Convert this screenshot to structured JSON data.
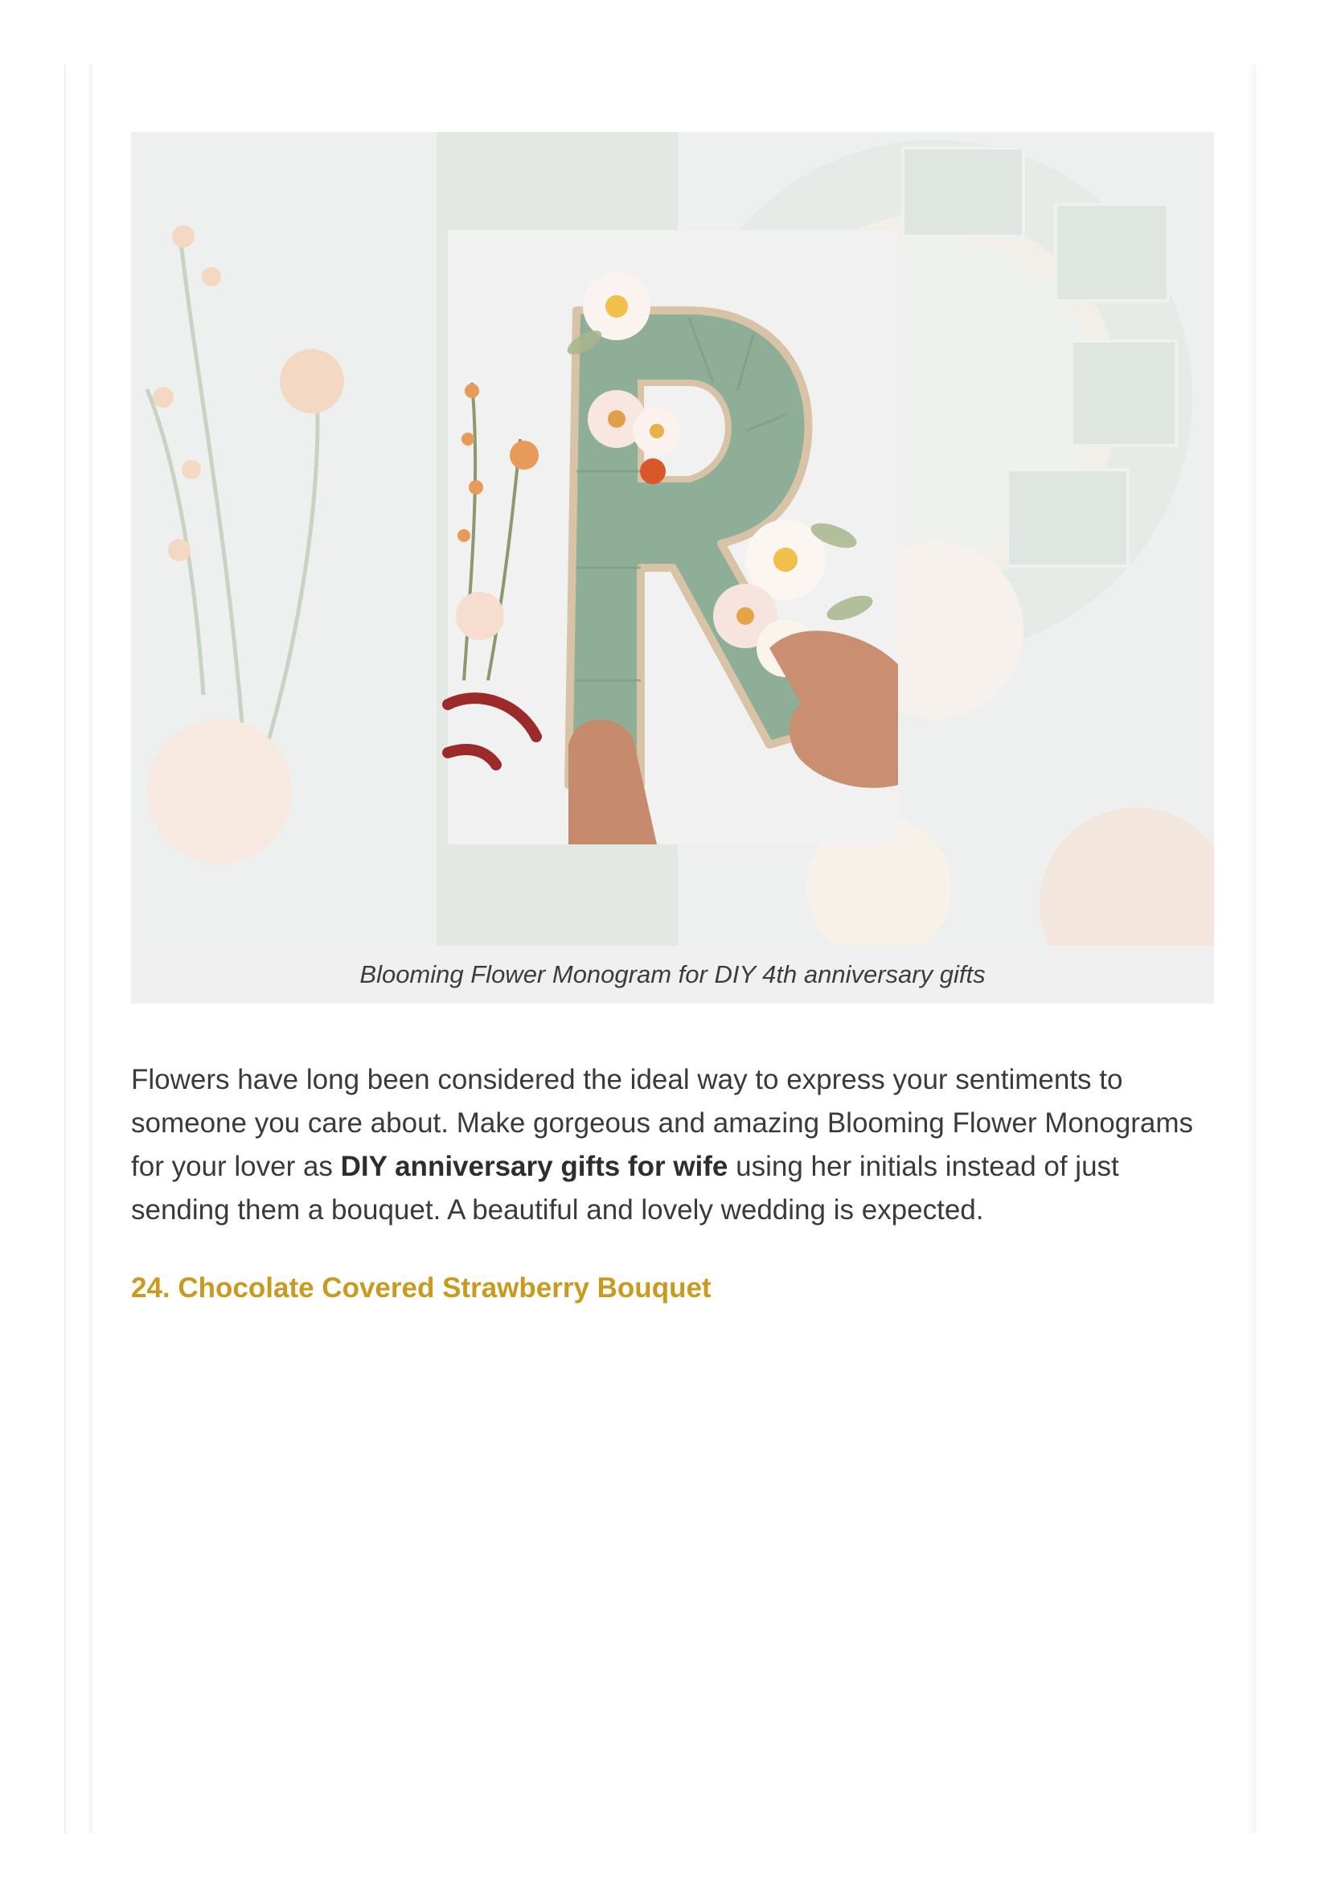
{
  "figure": {
    "image_subject": "blooming-flower-monogram-photo",
    "caption": "Blooming Flower Monogram for DIY 4th anniversary gifts"
  },
  "paragraph": {
    "part1": "Flowers have long been considered the ideal way to express your sentiments to someone you care about. Make gorgeous and amazing Blooming Flower Monograms for your lover as ",
    "link_text": "DIY anniversary gifts for wife",
    "part2": " using her initials instead of just sending them a bouquet. A beautiful and lovely wedding is expected."
  },
  "next_section": {
    "heading": "24. Chocolate Covered Strawberry Bouquet"
  },
  "colors": {
    "heading_accent": "#c99a1e",
    "caption_background": "#f0f0f0",
    "body_text": "#3a3a3a"
  }
}
